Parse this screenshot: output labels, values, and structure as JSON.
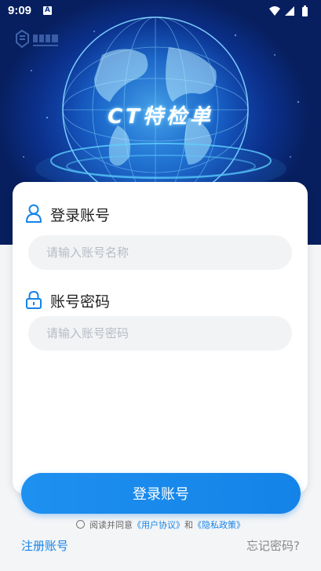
{
  "status_bar": {
    "time": "9:09",
    "notification_badge": "A"
  },
  "hero": {
    "app_title": "CT特检单"
  },
  "form": {
    "account_label": "登录账号",
    "account_placeholder": "请输入账号名称",
    "account_value": "",
    "password_label": "账号密码",
    "password_placeholder": "请输入账号密码",
    "password_value": ""
  },
  "actions": {
    "login_label": "登录账号",
    "register_label": "注册账号",
    "forgot_label": "忘记密码?"
  },
  "agreement": {
    "prefix": "阅读并同意",
    "user_agreement": "《用户协议》",
    "conjunction": "和",
    "privacy_policy": "《隐私政策》",
    "checked": false
  },
  "colors": {
    "accent": "#1483e8",
    "hero_dark": "#0b2f8a",
    "input_bg": "#f2f3f5"
  },
  "icons": {
    "account": "user-icon",
    "password": "lock-icon",
    "wifi": "wifi-icon",
    "signal": "signal-icon",
    "battery": "battery-icon"
  }
}
